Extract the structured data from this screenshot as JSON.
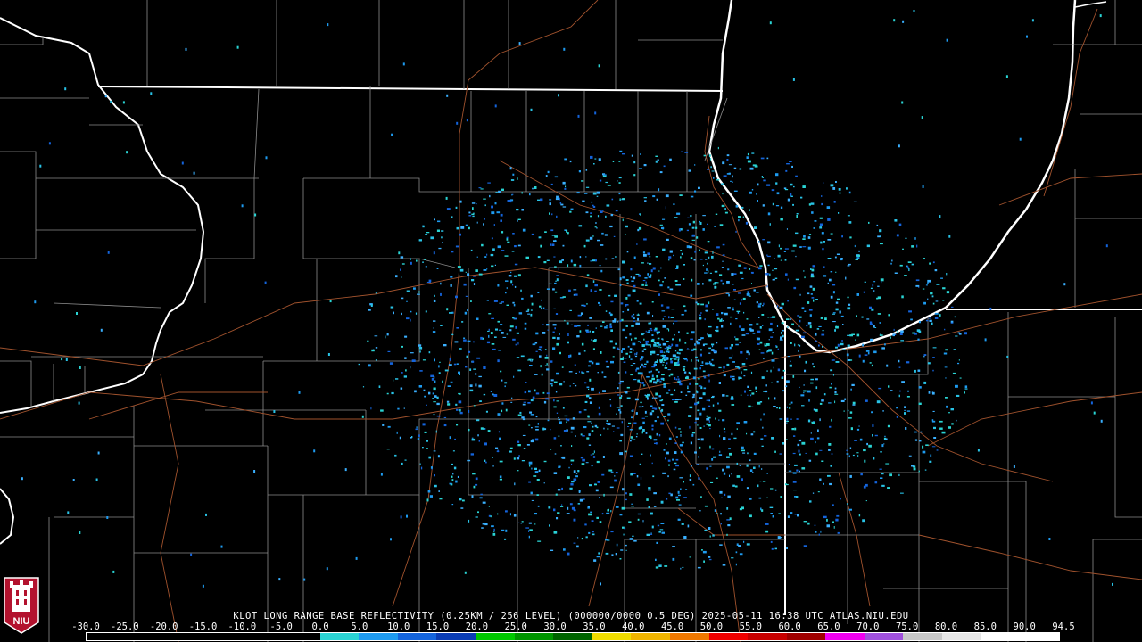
{
  "product_title": "KLOT LONG RANGE BASE REFLECTIVITY (0.25KM / 256 LEVEL) (000000/0000 0.5 DEG) 2025-05-11 16:38 UTC  ATLAS.NIU.EDU",
  "logo_text": "NIU",
  "scale": {
    "labels": [
      "-30.0",
      "-25.0",
      "-20.0",
      "-15.0",
      "-10.0",
      "-5.0",
      "0.0",
      "5.0",
      "10.0",
      "15.0",
      "20.0",
      "25.0",
      "30.0",
      "35.0",
      "40.0",
      "45.0",
      "50.0",
      "55.0",
      "60.0",
      "65.0",
      "70.0",
      "75.0",
      "80.0",
      "85.0",
      "90.0",
      "94.5"
    ],
    "colors": [
      "#000000",
      "#000000",
      "#000000",
      "#000000",
      "#000000",
      "#000000",
      "#2ad4d4",
      "#1e9bf0",
      "#1464dc",
      "#0a3cb4",
      "#00c800",
      "#009600",
      "#006400",
      "#f0dc00",
      "#f0b400",
      "#f07800",
      "#f00000",
      "#c80000",
      "#a00000",
      "#f000f0",
      "#a050dc",
      "#c8c8c8",
      "#e6e6e6",
      "#ffffff",
      "#ffffff"
    ]
  }
}
